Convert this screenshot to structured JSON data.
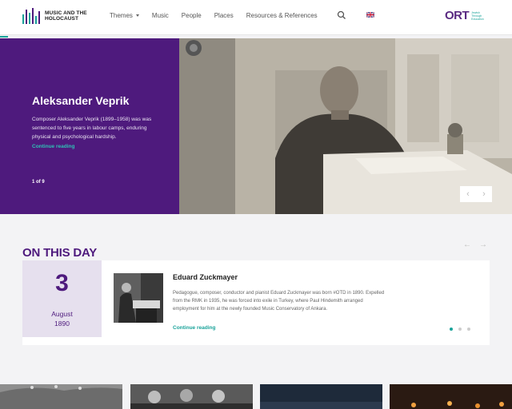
{
  "header": {
    "logo_text": "MUSIC AND THE HOLOCAUST",
    "nav": [
      {
        "label": "Themes",
        "has_dropdown": true
      },
      {
        "label": "Music"
      },
      {
        "label": "People"
      },
      {
        "label": "Places"
      },
      {
        "label": "Resources & References"
      }
    ],
    "search_icon": "search-icon",
    "language_icon": "uk-flag-icon",
    "partner_logo": {
      "letters": "ORT",
      "tagline": "Jewish Through Education"
    }
  },
  "hero": {
    "title": "Aleksander Veprik",
    "description": "Composer Aleksander Veprik (1899–1958) was was sentenced to five years in labour camps, enduring physical and psychological hardship.",
    "link": "Continue reading",
    "counter": "1 of 9",
    "prev": "‹",
    "next": "›"
  },
  "on_this_day": {
    "heading": "ON THIS DAY",
    "prev": "←",
    "next": "→",
    "day": "3",
    "month": "August",
    "year": "1890",
    "name": "Eduard Zuckmayer",
    "text": "Pedagogue, composer, conductor and pianist Eduard Zuckmayer was born #OTD in 1890. Expelled from the RMK in 1935, he was forced into exile in Turkey, where Paul Hindemith arranged employment for him at the newly founded Music Conservatory of Ankara.",
    "link": "Continue reading",
    "active_slide": 1,
    "slide_count": 3
  },
  "colors": {
    "purple": "#4e1a7d",
    "teal": "#1aa39a",
    "background": "#f3f3f5"
  }
}
